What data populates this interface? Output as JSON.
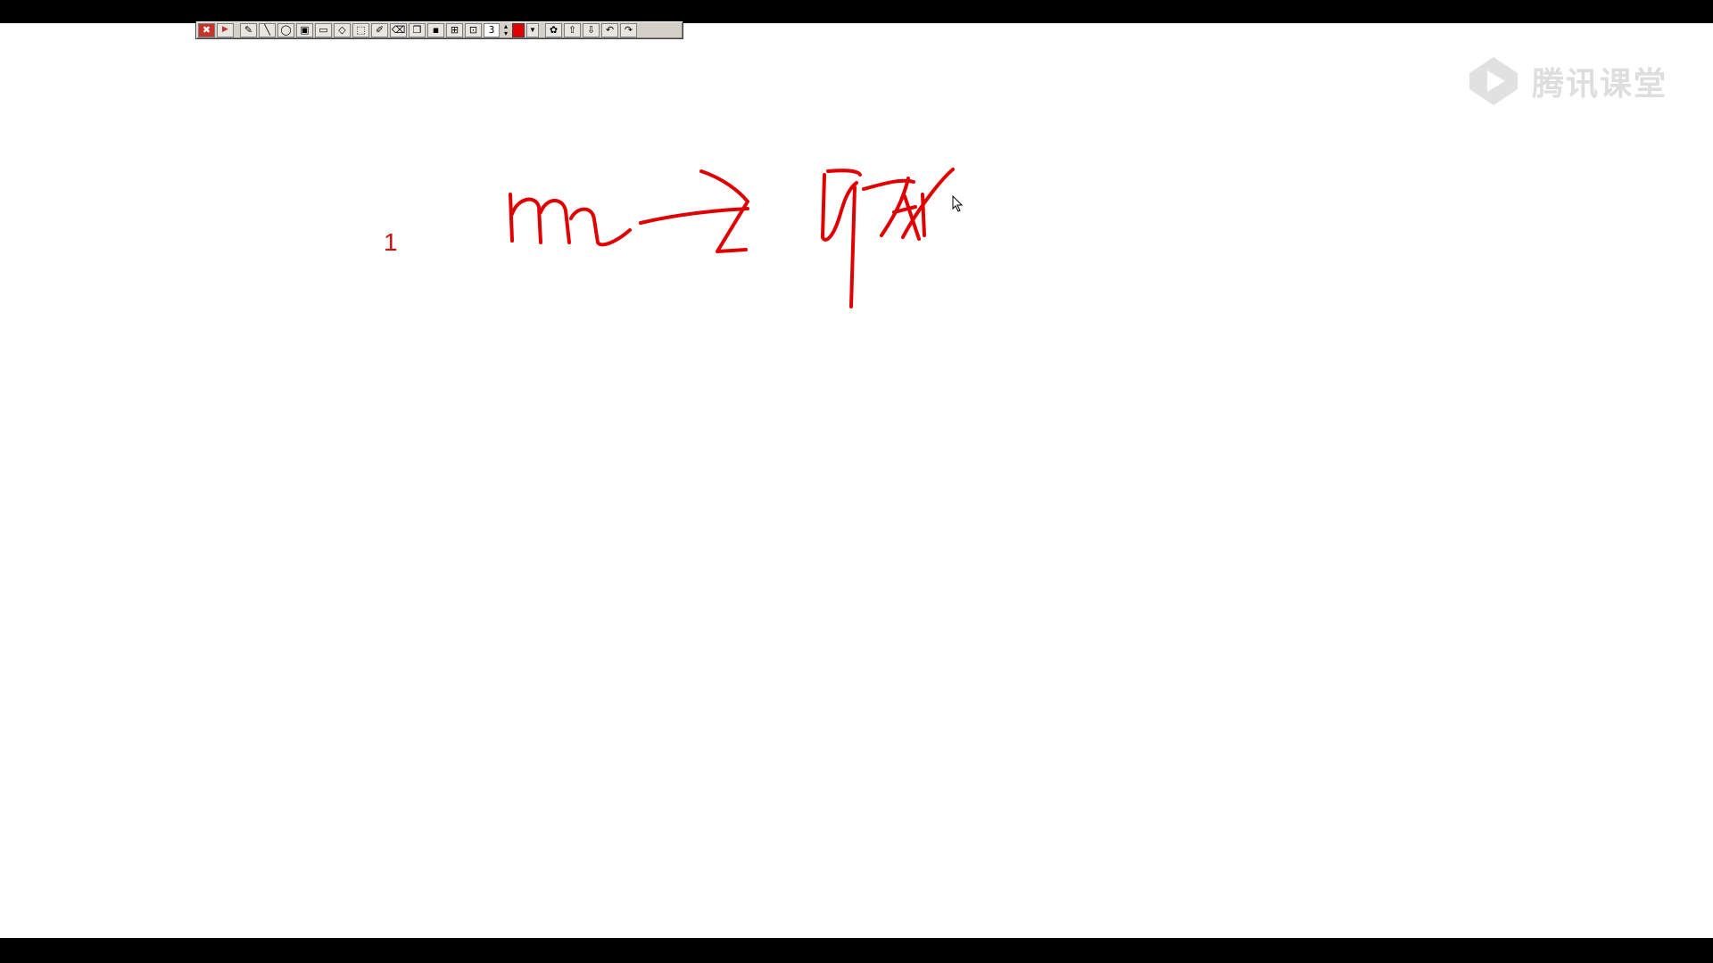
{
  "toolbar": {
    "pen_width": "3",
    "color": "#e00000",
    "tools": [
      {
        "icon": "close-icon",
        "glyph": "✖"
      },
      {
        "icon": "play-icon",
        "glyph": "▶"
      },
      {
        "icon": "pen-icon",
        "glyph": "✎"
      },
      {
        "icon": "line-icon",
        "glyph": "╲"
      },
      {
        "icon": "ellipse-icon",
        "glyph": "◯"
      },
      {
        "icon": "filled-rect-icon",
        "glyph": "▣"
      },
      {
        "icon": "rect-icon",
        "glyph": "▭"
      },
      {
        "icon": "fill-icon",
        "glyph": "◇"
      },
      {
        "icon": "select-icon",
        "glyph": "⬚"
      },
      {
        "icon": "text-icon",
        "glyph": "✐"
      },
      {
        "icon": "eraser-icon",
        "glyph": "⌫"
      },
      {
        "icon": "copy-icon",
        "glyph": "❐"
      },
      {
        "icon": "save-icon",
        "glyph": "▪"
      },
      {
        "icon": "open-icon",
        "glyph": "⊞"
      },
      {
        "icon": "image-icon",
        "glyph": "⊡"
      }
    ],
    "tools_right": [
      {
        "icon": "settings-icon",
        "glyph": "✿"
      },
      {
        "icon": "arrow-up-icon",
        "glyph": "⇧"
      },
      {
        "icon": "arrow-down-icon",
        "glyph": "⇩"
      },
      {
        "icon": "undo-icon",
        "glyph": "↶"
      },
      {
        "icon": "redo-icon",
        "glyph": "↷"
      }
    ]
  },
  "watermark": {
    "text": "腾讯课堂"
  },
  "page": {
    "number": "1"
  }
}
